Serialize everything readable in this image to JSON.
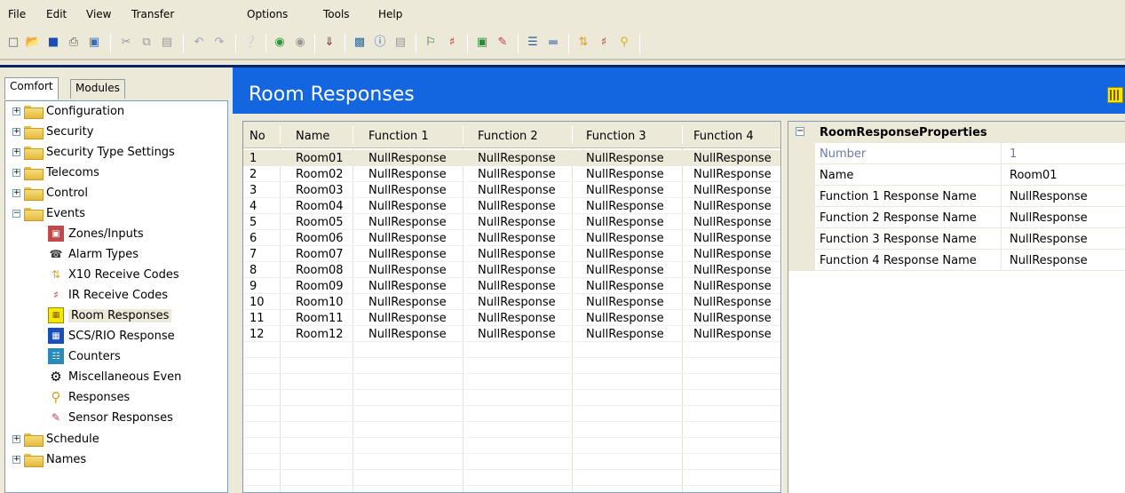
{
  "menu": [
    "File",
    "Edit",
    "View",
    "Transfer",
    "Options",
    "Tools",
    "Help"
  ],
  "tabs": [
    "Comfort",
    "Modules"
  ],
  "tree": {
    "top": [
      "Configuration",
      "Security",
      "Security Type Settings",
      "Telecoms",
      "Control"
    ],
    "events_label": "Events",
    "events_children": [
      "Zones/Inputs",
      "Alarm Types",
      "X10 Receive Codes",
      "IR Receive Codes",
      "Room Responses",
      "SCS/RIO Response",
      "Counters",
      "Miscellaneous Even",
      "Responses",
      "Sensor Responses"
    ],
    "bottom": [
      "Schedule",
      "Names"
    ]
  },
  "title": "Room Responses",
  "grid": {
    "headers": [
      "No",
      "Name",
      "Function 1",
      "Function 2",
      "Function 3",
      "Function 4"
    ],
    "rows": [
      [
        "1",
        "Room01",
        "NullResponse",
        "NullResponse",
        "NullResponse",
        "NullResponse"
      ],
      [
        "2",
        "Room02",
        "NullResponse",
        "NullResponse",
        "NullResponse",
        "NullResponse"
      ],
      [
        "3",
        "Room03",
        "NullResponse",
        "NullResponse",
        "NullResponse",
        "NullResponse"
      ],
      [
        "4",
        "Room04",
        "NullResponse",
        "NullResponse",
        "NullResponse",
        "NullResponse"
      ],
      [
        "5",
        "Room05",
        "NullResponse",
        "NullResponse",
        "NullResponse",
        "NullResponse"
      ],
      [
        "6",
        "Room06",
        "NullResponse",
        "NullResponse",
        "NullResponse",
        "NullResponse"
      ],
      [
        "7",
        "Room07",
        "NullResponse",
        "NullResponse",
        "NullResponse",
        "NullResponse"
      ],
      [
        "8",
        "Room08",
        "NullResponse",
        "NullResponse",
        "NullResponse",
        "NullResponse"
      ],
      [
        "9",
        "Room09",
        "NullResponse",
        "NullResponse",
        "NullResponse",
        "NullResponse"
      ],
      [
        "10",
        "Room10",
        "NullResponse",
        "NullResponse",
        "NullResponse",
        "NullResponse"
      ],
      [
        "11",
        "Room11",
        "NullResponse",
        "NullResponse",
        "NullResponse",
        "NullResponse"
      ],
      [
        "12",
        "Room12",
        "NullResponse",
        "NullResponse",
        "NullResponse",
        "NullResponse"
      ]
    ]
  },
  "properties": {
    "title": "RoomResponseProperties",
    "rows": [
      {
        "name": "Number",
        "value": "1"
      },
      {
        "name": "Name",
        "value": "Room01"
      },
      {
        "name": "Function 1 Response Name",
        "value": "NullResponse"
      },
      {
        "name": "Function 2 Response Name",
        "value": "NullResponse"
      },
      {
        "name": "Function 3 Response Name",
        "value": "NullResponse"
      },
      {
        "name": "Function 4 Response Name",
        "value": "NullResponse"
      }
    ]
  },
  "colors": {
    "title_bar": "#1466e0",
    "chrome": "#ece9d8",
    "dim_text": "#6e7ba8"
  }
}
